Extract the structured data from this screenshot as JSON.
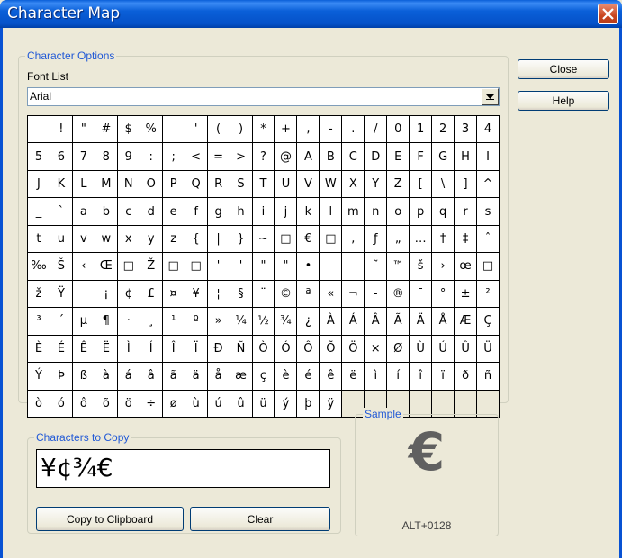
{
  "window": {
    "title": "Character Map",
    "close_icon": "close-x-icon"
  },
  "options": {
    "group_label": "Character Options",
    "font_list_label": "Font List",
    "font_value": "Arial"
  },
  "buttons": {
    "close": "Close",
    "help": "Help",
    "copy_to_clipboard": "Copy to Clipboard",
    "clear": "Clear"
  },
  "copy": {
    "group_label": "Characters to Copy",
    "value": "¥¢¾€"
  },
  "sample": {
    "group_label": "Sample",
    "glyph": "€",
    "code": "ALT+0128"
  },
  "grid": {
    "rows": [
      [
        " ",
        "!",
        "\"",
        "#",
        "$",
        "%",
        " ",
        "'",
        "(",
        ")",
        "*",
        "+",
        ",",
        "-",
        ".",
        "/",
        "0",
        "1",
        "2",
        "3",
        "4"
      ],
      [
        "5",
        "6",
        "7",
        "8",
        "9",
        ":",
        ";",
        "<",
        "=",
        ">",
        "?",
        "@",
        "A",
        "B",
        "C",
        "D",
        "E",
        "F",
        "G",
        "H",
        "I"
      ],
      [
        "J",
        "K",
        "L",
        "M",
        "N",
        "O",
        "P",
        "Q",
        "R",
        "S",
        "T",
        "U",
        "V",
        "W",
        "X",
        "Y",
        "Z",
        "[",
        "\\",
        "]",
        "^"
      ],
      [
        "_",
        "`",
        "a",
        "b",
        "c",
        "d",
        "e",
        "f",
        "g",
        "h",
        "i",
        "j",
        "k",
        "l",
        "m",
        "n",
        "o",
        "p",
        "q",
        "r",
        "s"
      ],
      [
        "t",
        "u",
        "v",
        "w",
        "x",
        "y",
        "z",
        "{",
        "|",
        "}",
        "~",
        "□",
        "€",
        "□",
        ",",
        "ƒ",
        "„",
        "…",
        "†",
        "‡",
        "ˆ"
      ],
      [
        "‰",
        "Š",
        "‹",
        "Œ",
        "□",
        "Ž",
        "□",
        "□",
        "'",
        "'",
        "\"",
        "\"",
        "•",
        "–",
        "—",
        "˜",
        "™",
        "š",
        "›",
        "œ",
        "□"
      ],
      [
        "ž",
        "Ÿ",
        " ",
        "¡",
        "¢",
        "£",
        "¤",
        "¥",
        "¦",
        "§",
        "¨",
        "©",
        "ª",
        "«",
        "¬",
        "-",
        "®",
        "¯",
        "°",
        "±",
        "²"
      ],
      [
        "³",
        "´",
        "µ",
        "¶",
        "·",
        "¸",
        "¹",
        "º",
        "»",
        "¼",
        "½",
        "¾",
        "¿",
        "À",
        "Á",
        "Â",
        "Ã",
        "Ä",
        "Å",
        "Æ",
        "Ç"
      ],
      [
        "È",
        "É",
        "Ê",
        "Ë",
        "Ì",
        "Í",
        "Î",
        "Ï",
        "Ð",
        "Ñ",
        "Ò",
        "Ó",
        "Ô",
        "Õ",
        "Ö",
        "×",
        "Ø",
        "Ù",
        "Ú",
        "Û",
        "Ü"
      ],
      [
        "Ý",
        "Þ",
        "ß",
        "à",
        "á",
        "â",
        "ã",
        "ä",
        "å",
        "æ",
        "ç",
        "è",
        "é",
        "ê",
        "ë",
        "ì",
        "í",
        "î",
        "ï",
        "ð",
        "ñ"
      ],
      [
        "ò",
        "ó",
        "ô",
        "õ",
        "ö",
        "÷",
        "ø",
        "ù",
        "ú",
        "û",
        "ü",
        "ý",
        "þ",
        "ÿ"
      ]
    ]
  }
}
